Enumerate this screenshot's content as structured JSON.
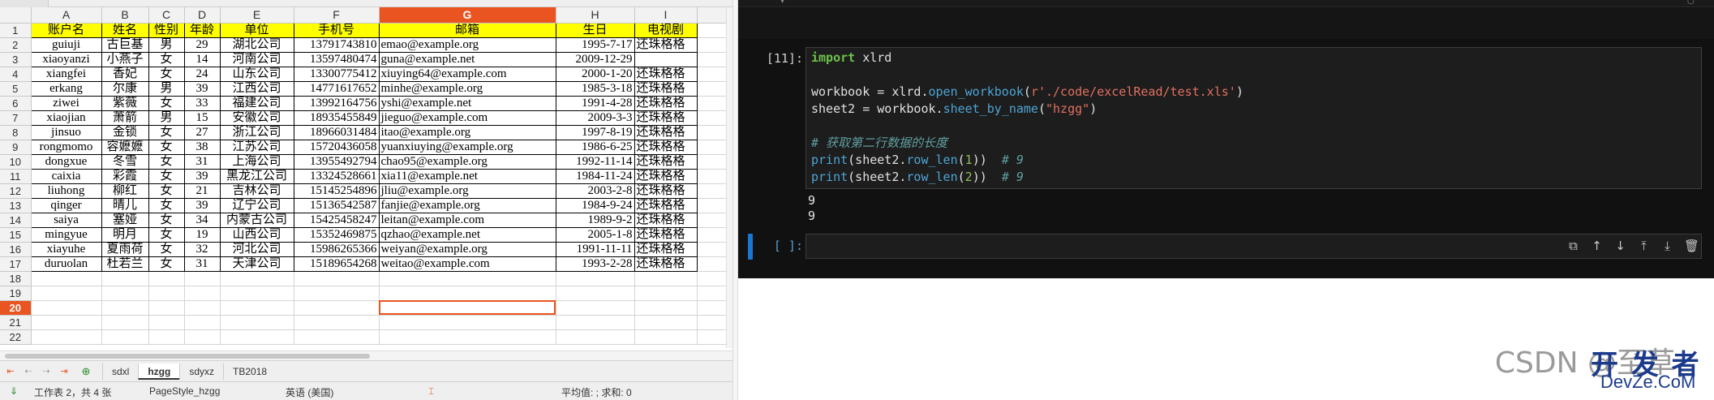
{
  "sheet": {
    "columns": [
      "A",
      "B",
      "C",
      "D",
      "E",
      "F",
      "G",
      "H",
      "I"
    ],
    "selected_column": "G",
    "selected_row": "20",
    "rows": [
      {
        "n": "1",
        "cells": [
          "账户名",
          "姓名",
          "性别",
          "年龄",
          "单位",
          "手机号",
          "邮箱",
          "生日",
          "电视剧"
        ]
      },
      {
        "n": "2",
        "cells": [
          "guiuji",
          "古巨基",
          "男",
          "29",
          "湖北公司",
          "13791743810",
          "emao@example.org",
          "1995-7-17",
          "还珠格格"
        ]
      },
      {
        "n": "3",
        "cells": [
          "xiaoyanzi",
          "小燕子",
          "女",
          "14",
          "河南公司",
          "13597480474",
          "guna@example.net",
          "2009-12-29",
          ""
        ]
      },
      {
        "n": "4",
        "cells": [
          "xiangfei",
          "香妃",
          "女",
          "24",
          "山东公司",
          "13300775412",
          "xiuying64@example.com",
          "2000-1-20",
          "还珠格格"
        ]
      },
      {
        "n": "5",
        "cells": [
          "erkang",
          "尔康",
          "男",
          "39",
          "江西公司",
          "14771617652",
          "minhe@example.org",
          "1985-3-18",
          "还珠格格"
        ]
      },
      {
        "n": "6",
        "cells": [
          "ziwei",
          "紫薇",
          "女",
          "33",
          "福建公司",
          "13992164756",
          "yshi@example.net",
          "1991-4-28",
          "还珠格格"
        ]
      },
      {
        "n": "7",
        "cells": [
          "xiaojian",
          "萧箭",
          "男",
          "15",
          "安徽公司",
          "18935455849",
          "jieguo@example.com",
          "2009-3-3",
          "还珠格格"
        ]
      },
      {
        "n": "8",
        "cells": [
          "jinsuo",
          "金锁",
          "女",
          "27",
          "浙江公司",
          "18966031484",
          "itao@example.org",
          "1997-8-19",
          "还珠格格"
        ]
      },
      {
        "n": "9",
        "cells": [
          "rongmomo",
          "容嬷嬷",
          "女",
          "38",
          "江苏公司",
          "15720436058",
          "yuanxiuying@example.org",
          "1986-6-25",
          "还珠格格"
        ]
      },
      {
        "n": "10",
        "cells": [
          "dongxue",
          "冬雪",
          "女",
          "31",
          "上海公司",
          "13955492794",
          "chao95@example.org",
          "1992-11-14",
          "还珠格格"
        ]
      },
      {
        "n": "11",
        "cells": [
          "caixia",
          "彩霞",
          "女",
          "39",
          "黑龙江公司",
          "13324528661",
          "xia11@example.net",
          "1984-11-24",
          "还珠格格"
        ]
      },
      {
        "n": "12",
        "cells": [
          "liuhong",
          "柳红",
          "女",
          "21",
          "吉林公司",
          "15145254896",
          "jliu@example.org",
          "2003-2-8",
          "还珠格格"
        ]
      },
      {
        "n": "13",
        "cells": [
          "qinger",
          "晴儿",
          "女",
          "39",
          "辽宁公司",
          "15136542587",
          "fanjie@example.org",
          "1984-9-24",
          "还珠格格"
        ]
      },
      {
        "n": "14",
        "cells": [
          "saiya",
          "塞娅",
          "女",
          "34",
          "内蒙古公司",
          "15425458247",
          "leitan@example.com",
          "1989-9-2",
          "还珠格格"
        ]
      },
      {
        "n": "15",
        "cells": [
          "mingyue",
          "明月",
          "女",
          "19",
          "山西公司",
          "15352469875",
          "qzhao@example.net",
          "2005-1-8",
          "还珠格格"
        ]
      },
      {
        "n": "16",
        "cells": [
          "xiayuhe",
          "夏雨荷",
          "女",
          "32",
          "河北公司",
          "15986265366",
          "weiyan@example.org",
          "1991-11-11",
          "还珠格格"
        ]
      },
      {
        "n": "17",
        "cells": [
          "duruolan",
          "杜若兰",
          "女",
          "31",
          "天津公司",
          "15189654268",
          "weitao@example.com",
          "1993-2-28",
          "还珠格格"
        ]
      },
      {
        "n": "18",
        "cells": []
      },
      {
        "n": "19",
        "cells": []
      },
      {
        "n": "20",
        "cells": []
      },
      {
        "n": "21",
        "cells": []
      },
      {
        "n": "22",
        "cells": []
      }
    ],
    "tabs": [
      "sdxl",
      "hzgg",
      "sdyxz",
      "TB2018"
    ],
    "active_tab": "hzgg",
    "status": {
      "sheet_info": "工作表 2，共 4 张",
      "page_style": "PageStyle_hzgg",
      "language": "英语 (美国)",
      "summary": "平均值: ; 求和: 0"
    }
  },
  "notebook": {
    "cell1": {
      "prompt": "[11]:",
      "output": [
        "9",
        "9"
      ]
    },
    "cell2": {
      "prompt": "[ ]:"
    }
  },
  "watermark": {
    "text": "CSDN @至草",
    "logo_line1": "开 发 者",
    "logo_line2": "DevZe.CoM"
  },
  "colors": {
    "accent": "#e95420",
    "header_fill": "#ffff00",
    "notebook_bg": "#111111",
    "active_cell_bar": "#1976d2"
  }
}
